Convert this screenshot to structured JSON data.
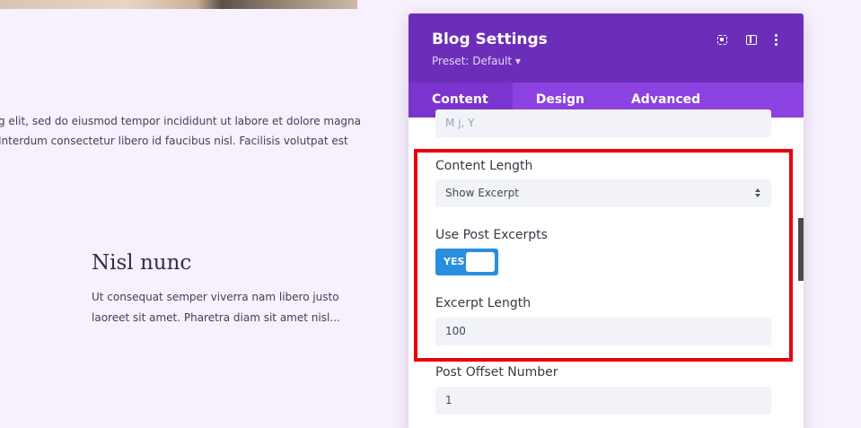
{
  "background": {
    "paragraph_line1": "g elit, sed do eiusmod tempor incididunt ut labore et dolore magna",
    "paragraph_line2": "Interdum consectetur libero id faucibus nisl. Facilisis volutpat est",
    "post_title": "Nisl nunc",
    "post_excerpt_line1": "Ut consequat semper viverra nam libero justo",
    "post_excerpt_line2": "laoreet sit amet. Pharetra diam sit amet nisl..."
  },
  "panel": {
    "title": "Blog Settings",
    "preset": "Preset: Default ▾",
    "icons": [
      "focus-icon",
      "split-view-icon",
      "more-icon"
    ],
    "tabs": [
      {
        "label": "Content",
        "active": true
      },
      {
        "label": "Design",
        "active": false
      },
      {
        "label": "Advanced",
        "active": false
      }
    ],
    "fields": {
      "date_format_value": "M j, Y",
      "content_length_label": "Content Length",
      "content_length_value": "Show Excerpt",
      "use_post_excerpts_label": "Use Post Excerpts",
      "use_post_excerpts_toggle": "YES",
      "excerpt_length_label": "Excerpt Length",
      "excerpt_length_value": "100",
      "post_offset_label": "Post Offset Number",
      "post_offset_value": "1"
    }
  },
  "colors": {
    "page_bg": "#f7f0fd",
    "header": "#6c2eb9",
    "tabs": "#8b42e0",
    "toggle": "#2a8ede",
    "highlight": "#e8000c"
  }
}
